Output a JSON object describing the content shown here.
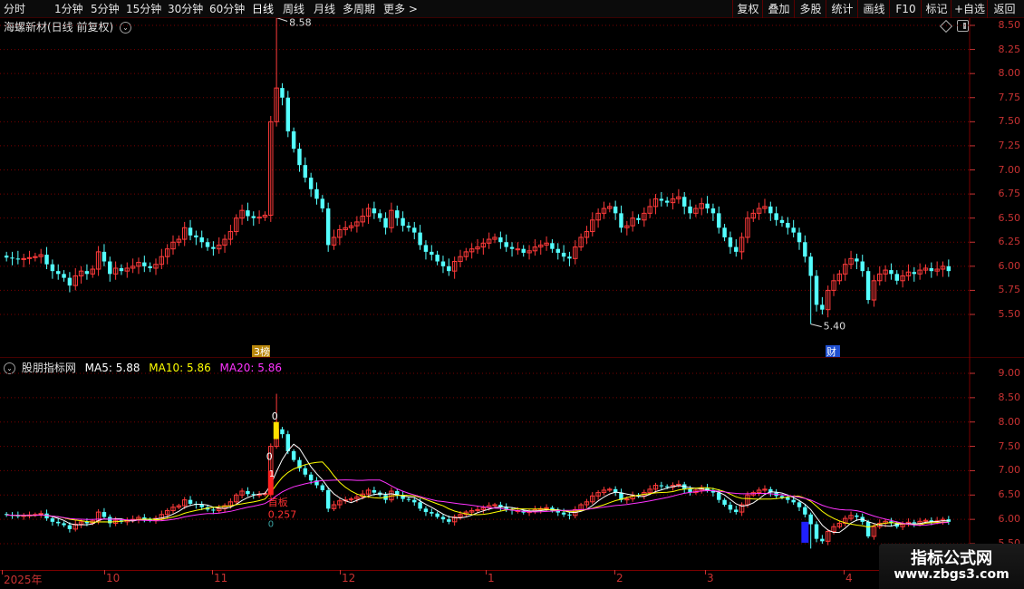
{
  "toolbar": {
    "periods": [
      "分时",
      "1分钟",
      "5分钟",
      "15分钟",
      "30分钟",
      "60分钟",
      "日线",
      "周线",
      "月线",
      "多周期",
      "更多 >"
    ],
    "active_period": "日线",
    "right_buttons": [
      "复权",
      "叠加",
      "多股",
      "统计",
      "画线",
      "F10",
      "标记",
      "+自选",
      "返回"
    ]
  },
  "price_panel": {
    "title": "海螺新材(日线 前复权)",
    "high_label": "8.58",
    "low_label": "5.40",
    "badge_lhb": "榜",
    "badge_lhb_prefix": "3",
    "badge_cai": "财",
    "y_ticks": [
      "8.50",
      "8.25",
      "8.00",
      "7.75",
      "7.50",
      "7.25",
      "7.00",
      "6.75",
      "6.50",
      "6.25",
      "6.00",
      "5.75",
      "5.50"
    ]
  },
  "indicator_panel": {
    "name": "股朋指标网",
    "ma5_label": "MA5:",
    "ma5_value": "5.88",
    "ma10_label": "MA10:",
    "ma10_value": "5.86",
    "ma20_label": "MA20:",
    "ma20_value": "5.86",
    "y_ticks": [
      "9.00",
      "8.50",
      "8.00",
      "7.50",
      "7.00",
      "6.50",
      "6.00",
      "5.50"
    ],
    "signal_labels": {
      "yellow_top": "0",
      "red_top": "0",
      "red_one": "1",
      "board_text": "首板",
      "board_value": "0.257",
      "board_zero": "0"
    },
    "colors": {
      "ma5": "#ffffff",
      "ma10": "#ffff00",
      "ma20": "#ff33ff"
    }
  },
  "x_axis": {
    "labels": [
      "2025年",
      "10",
      "11",
      "12",
      "1",
      "2",
      "3",
      "4"
    ]
  },
  "watermark": {
    "line1": "指标公式网",
    "line2": "www.zbgs3.com"
  },
  "colors": {
    "up": "#ff3a3a",
    "down": "#54ffff",
    "grid": "#7a0000"
  },
  "chart_data": {
    "type": "candlestick",
    "close": [
      6.09,
      6.08,
      6.07,
      6.08,
      6.09,
      6.1,
      6.12,
      6.02,
      5.95,
      5.92,
      5.88,
      5.8,
      5.9,
      5.95,
      5.92,
      5.97,
      6.15,
      6.05,
      5.92,
      5.98,
      5.95,
      5.98,
      6.0,
      6.04,
      6.0,
      5.98,
      6.02,
      6.1,
      6.18,
      6.25,
      6.28,
      6.4,
      6.32,
      6.3,
      6.25,
      6.2,
      6.18,
      6.22,
      6.28,
      6.36,
      6.5,
      6.58,
      6.52,
      6.5,
      6.51,
      6.53,
      7.5,
      7.85,
      7.75,
      7.4,
      7.22,
      7.05,
      6.92,
      6.8,
      6.7,
      6.6,
      6.22,
      6.3,
      6.38,
      6.4,
      6.42,
      6.46,
      6.52,
      6.6,
      6.55,
      6.5,
      6.4,
      6.58,
      6.5,
      6.42,
      6.4,
      6.35,
      6.22,
      6.15,
      6.12,
      6.05,
      6.0,
      5.95,
      6.05,
      6.1,
      6.15,
      6.18,
      6.2,
      6.24,
      6.28,
      6.3,
      6.25,
      6.2,
      6.18,
      6.18,
      6.14,
      6.16,
      6.2,
      6.22,
      6.24,
      6.18,
      6.14,
      6.1,
      6.08,
      6.2,
      6.3,
      6.36,
      6.48,
      6.55,
      6.6,
      6.62,
      6.55,
      6.4,
      6.42,
      6.5,
      6.48,
      6.55,
      6.62,
      6.7,
      6.68,
      6.66,
      6.7,
      6.72,
      6.62,
      6.55,
      6.6,
      6.65,
      6.6,
      6.55,
      6.4,
      6.3,
      6.2,
      6.15,
      6.3,
      6.5,
      6.55,
      6.6,
      6.62,
      6.55,
      6.48,
      6.45,
      6.4,
      6.35,
      6.25,
      6.1,
      5.9,
      5.6,
      5.55,
      5.75,
      5.85,
      5.92,
      6.02,
      6.08,
      6.05,
      5.95,
      5.65,
      5.85,
      5.92,
      5.96,
      5.92,
      5.85,
      5.9,
      5.94,
      5.92,
      5.96,
      5.98,
      5.95,
      5.97,
      6.0,
      5.95
    ]
  }
}
